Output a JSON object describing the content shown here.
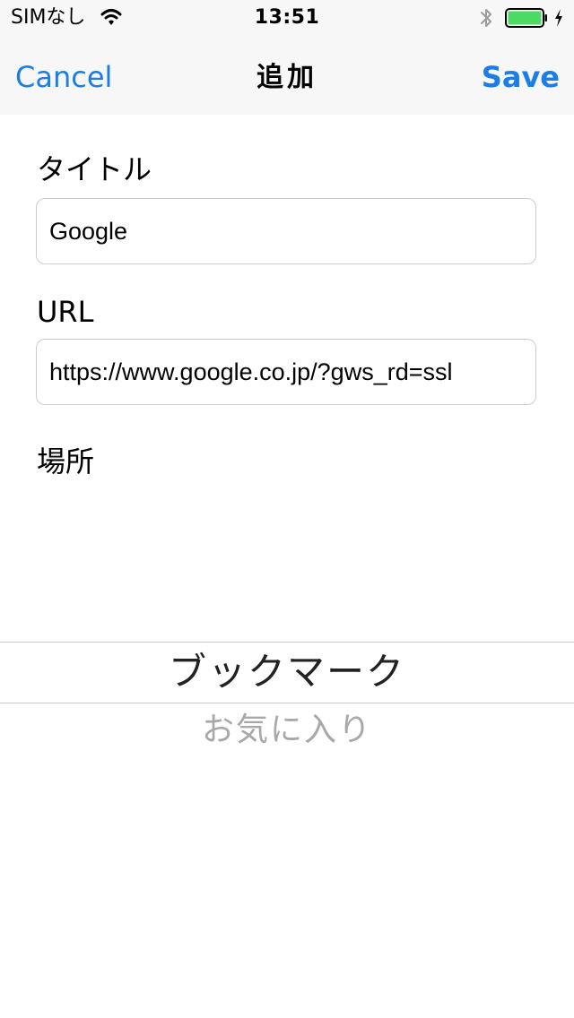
{
  "status_bar": {
    "carrier": "SIMなし",
    "time": "13:51",
    "battery_level": 1.0,
    "battery_color": "#4cd964",
    "charging": true,
    "icons": [
      "wifi-icon",
      "bluetooth-icon",
      "battery-icon",
      "charging-bolt-icon"
    ]
  },
  "nav": {
    "cancel_label": "Cancel",
    "title": "追加",
    "save_label": "Save",
    "accent_color": "#1a7ee6"
  },
  "form": {
    "title_label": "タイトル",
    "title_value": "Google",
    "url_label": "URL",
    "url_value": "https://www.google.co.jp/?gws_rd=ssl",
    "location_label": "場所"
  },
  "picker": {
    "selected": "ブックマーク",
    "options": [
      "ブックマーク",
      "お気に入り"
    ]
  }
}
